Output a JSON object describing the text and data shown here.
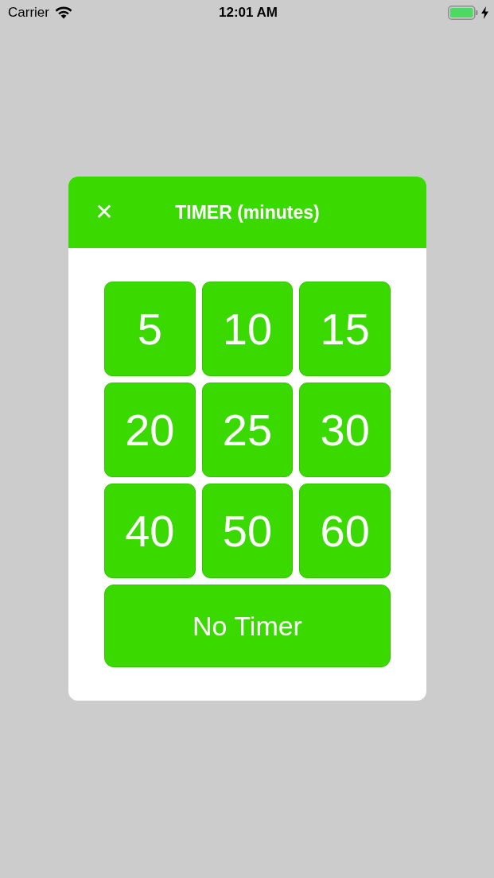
{
  "status_bar": {
    "carrier": "Carrier",
    "time": "12:01 AM"
  },
  "dialog": {
    "title": "TIMER (minutes)",
    "close_label": "✕",
    "options": [
      {
        "label": "5"
      },
      {
        "label": "10"
      },
      {
        "label": "15"
      },
      {
        "label": "20"
      },
      {
        "label": "25"
      },
      {
        "label": "30"
      },
      {
        "label": "40"
      },
      {
        "label": "50"
      },
      {
        "label": "60"
      }
    ],
    "no_timer_button": {
      "label": "No Timer"
    }
  }
}
